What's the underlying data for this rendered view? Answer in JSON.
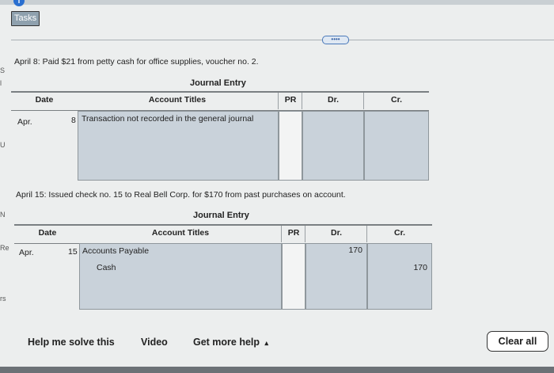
{
  "header": {
    "tasks_label": "Tasks",
    "more_label": "••••"
  },
  "edge_letters": [
    "S",
    "l",
    "U",
    "N",
    "Re",
    "rs"
  ],
  "entry1": {
    "prompt": "April 8: Paid $21 from petty cash for office supplies, voucher no. 2.",
    "title": "Journal Entry",
    "columns": {
      "date": "Date",
      "account": "Account Titles",
      "pr": "PR",
      "dr": "Dr.",
      "cr": "Cr."
    },
    "month": "Apr.",
    "day": "8",
    "account_line1": "Transaction not recorded in the general journal"
  },
  "entry2": {
    "prompt": "April 15: Issued check no. 15 to Real Bell Corp. for $170 from past purchases on account.",
    "title": "Journal Entry",
    "columns": {
      "date": "Date",
      "account": "Account Titles",
      "pr": "PR",
      "dr": "Dr.",
      "cr": "Cr."
    },
    "month": "Apr.",
    "day": "15",
    "account_line1": "Accounts Payable",
    "account_line2": "Cash",
    "dr_line1": "170",
    "cr_line2": "170"
  },
  "footer": {
    "help_label": "Help me solve this",
    "video_label": "Video",
    "more_help_label": "Get more help",
    "more_help_caret": "▴",
    "clear_label": "Clear all"
  }
}
